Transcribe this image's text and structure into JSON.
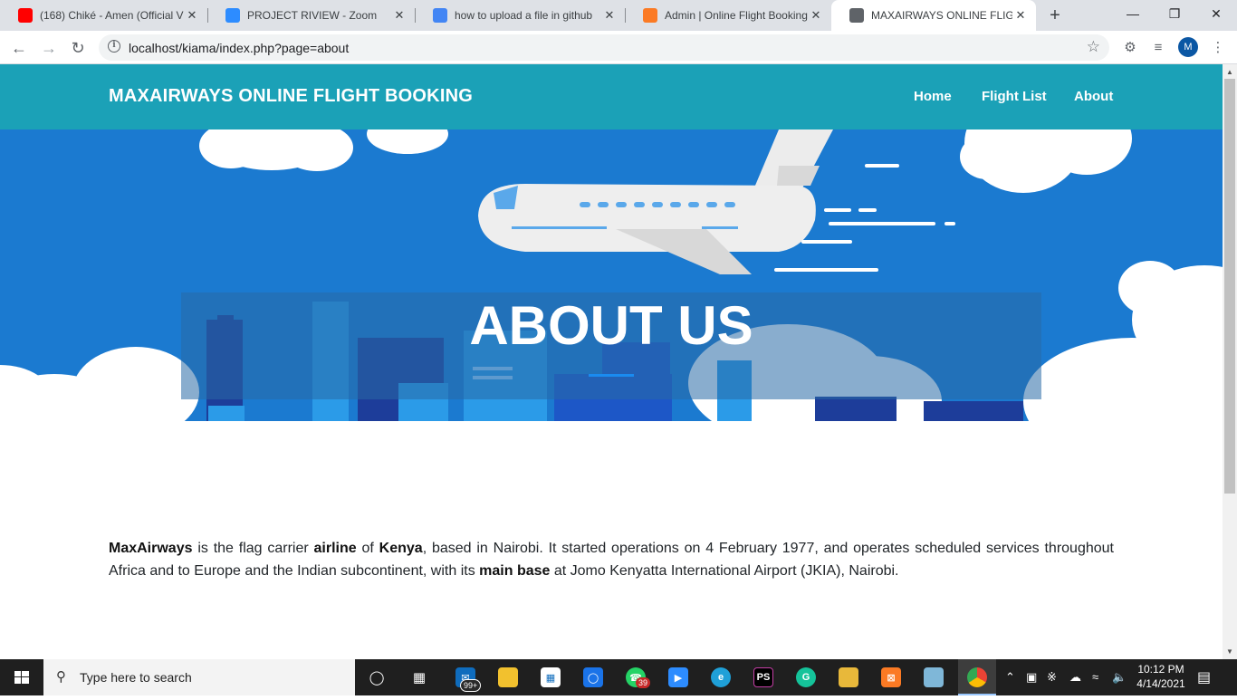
{
  "browser": {
    "tabs": [
      {
        "title": "(168) Chiké - Amen (Official Vi",
        "icon": "youtube-icon",
        "color": "#ff0000",
        "active": false
      },
      {
        "title": "PROJECT RIVIEW - Zoom",
        "icon": "zoom-icon",
        "color": "#2d8cff",
        "active": false
      },
      {
        "title": "how to upload a file in github",
        "icon": "google-icon",
        "color": "#4285f4",
        "active": false
      },
      {
        "title": "Admin | Online Flight Booking",
        "icon": "xampp-icon",
        "color": "#fb7a24",
        "active": false
      },
      {
        "title": "MAXAIRWAYS ONLINE FLIGHT",
        "icon": "globe-icon",
        "color": "#5f6368",
        "active": true
      }
    ],
    "url": "localhost/kiama/index.php?page=about",
    "profile_initial": "M"
  },
  "site": {
    "brand": "MAXAIRWAYS ONLINE FLIGHT BOOKING",
    "nav": [
      "Home",
      "Flight List",
      "About"
    ],
    "hero_title": "ABOUT US",
    "about_segments": [
      {
        "text": "MaxAirways",
        "bold": true
      },
      {
        "text": " is the flag carrier ",
        "bold": false
      },
      {
        "text": "airline",
        "bold": true
      },
      {
        "text": " of ",
        "bold": false
      },
      {
        "text": "Kenya",
        "bold": true
      },
      {
        "text": ", based in Nairobi. It started operations on 4 February 1977, and operates scheduled services throughout Africa and to Europe and the Indian subcontinent, with its ",
        "bold": false
      },
      {
        "text": "main base",
        "bold": true
      },
      {
        "text": " at Jomo Kenyatta International Airport (JKIA), Nairobi.",
        "bold": false
      }
    ],
    "colors": {
      "navbar": "#1ba1b7",
      "hero_sky": "#1b7ad0"
    }
  },
  "taskbar": {
    "search_placeholder": "Type here to search",
    "mail_badge": "99+",
    "whatsapp_badge": "39",
    "time": "10:12 PM",
    "date": "4/14/2021"
  }
}
